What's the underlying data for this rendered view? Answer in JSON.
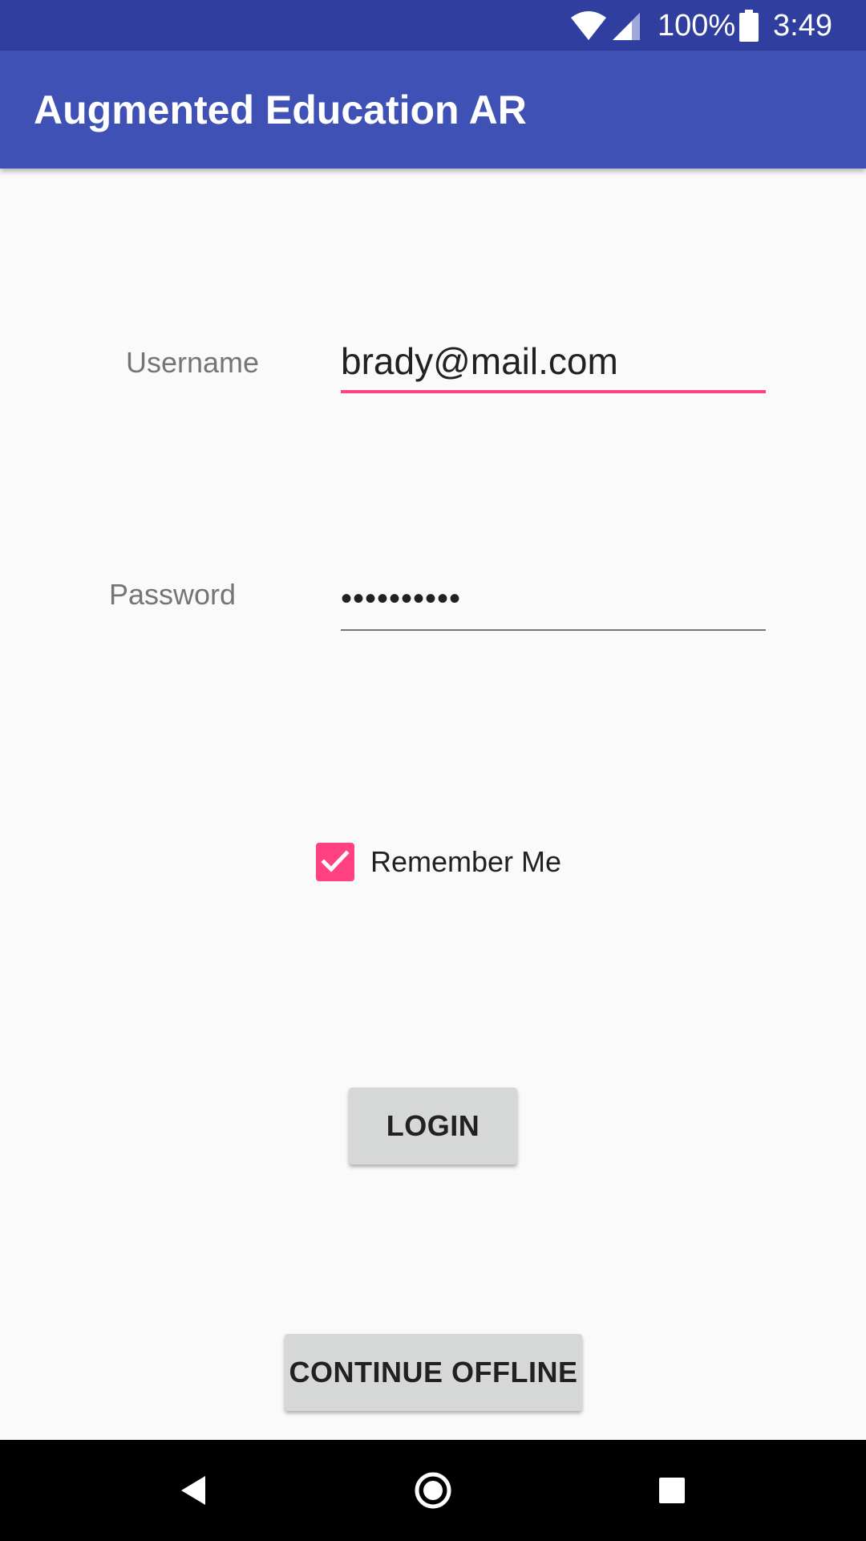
{
  "status_bar": {
    "battery_percent": "100%",
    "time": "3:49",
    "icons": [
      "wifi-icon",
      "cell-signal-icon",
      "battery-icon"
    ]
  },
  "app_bar": {
    "title": "Augmented Education AR"
  },
  "form": {
    "username_label": "Username",
    "username_value": "brady@mail.com",
    "password_label": "Password",
    "password_value": "••••••••••",
    "remember_label": "Remember Me",
    "remember_checked": true,
    "login_label": "LOGIN",
    "offline_label": "CONTINUE OFFLINE"
  },
  "nav_bar": {
    "icons": [
      "back-icon",
      "home-icon",
      "recents-icon"
    ]
  },
  "colors": {
    "primary_dark": "#303f9f",
    "primary": "#3f51b5",
    "accent": "#ff4081",
    "background": "#fafafa",
    "button": "#d6d7d7"
  }
}
